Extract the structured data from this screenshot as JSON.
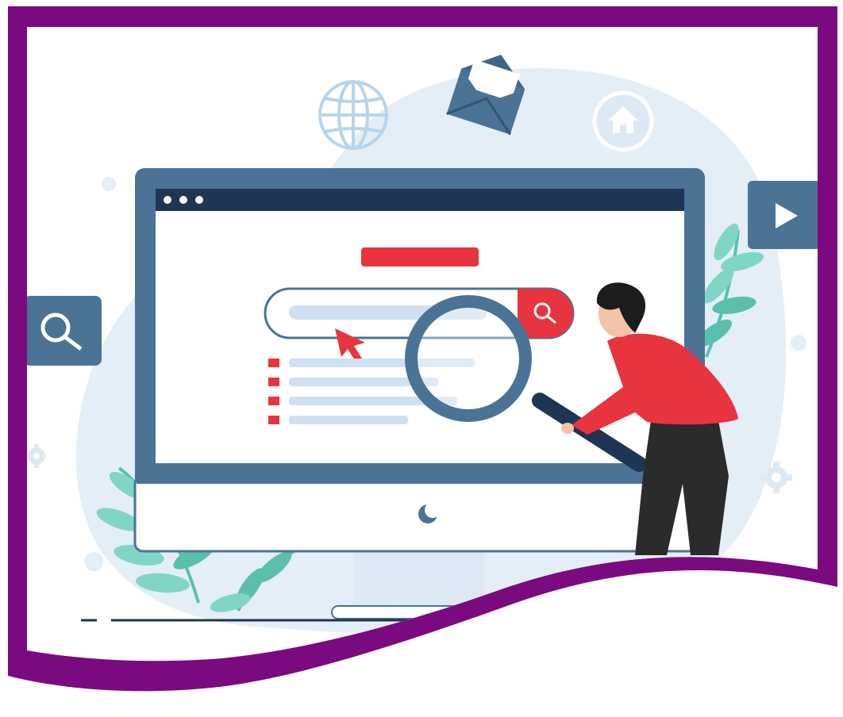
{
  "illustration": {
    "subject": "",
    "colors": {
      "frame": "#7b0a80",
      "monitor": "#4a7396",
      "monitor_dark": "#1e3553",
      "accent_red": "#e8343f",
      "bar_light": "#cfe1f1",
      "blob": "#e4eef7",
      "leaf": "#7fd6c6",
      "leaf_dark": "#5bbfae",
      "shirt": "#e8343f",
      "pants": "#2b2b2b",
      "hair": "#1c1c1c",
      "skin": "#f2c3a6"
    },
    "icons": {
      "globe": "globe-icon",
      "mail": "mail-icon",
      "home": "home-icon",
      "play": "play-icon",
      "search_tile": "search-icon",
      "search_button": "search-icon",
      "cursor": "cursor-arrow-icon",
      "magnifier": "magnifying-glass-icon",
      "gear": "gear-icon"
    },
    "result_list_count": 4
  }
}
